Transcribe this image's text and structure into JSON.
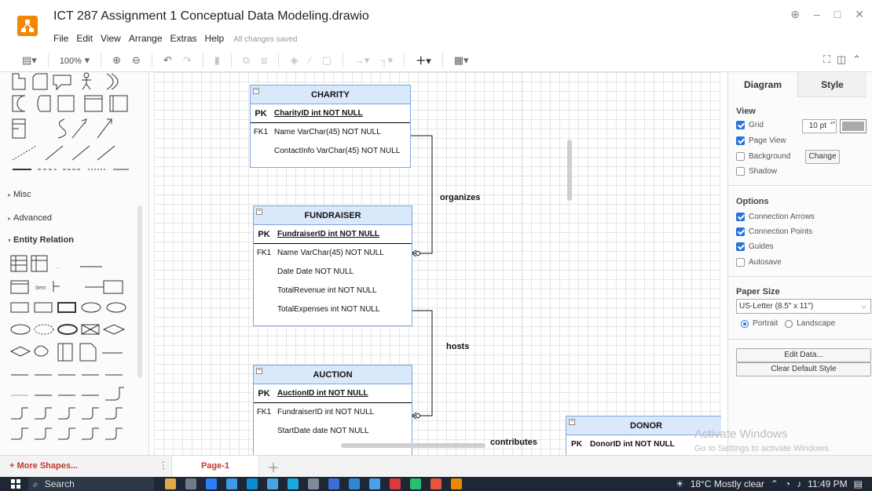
{
  "window": {
    "title": "ICT 287 Assignment 1 Conceptual Data Modeling.drawio",
    "save_status": "All changes saved",
    "menu": [
      "File",
      "Edit",
      "View",
      "Arrange",
      "Extras",
      "Help"
    ]
  },
  "toolbar": {
    "zoom": "100%",
    "icons": [
      "format-panel-toggle",
      "zoom-in-icon",
      "zoom-out-icon",
      "undo-icon",
      "redo-icon",
      "delete-icon",
      "to-front-icon",
      "to-back-icon",
      "fill-color-icon",
      "line-color-icon",
      "shadow-icon",
      "connection-icon",
      "waypoints-icon",
      "insert-plus-icon",
      "table-icon",
      "fullscreen-icon",
      "collapse-icon"
    ]
  },
  "shapes_panel": {
    "sections": {
      "misc": "Misc",
      "advanced": "Advanced",
      "entity_relation": "Entity Relation"
    },
    "item_label": "Item",
    "more_shapes": "+ More Shapes..."
  },
  "diagram": {
    "entities": {
      "charity": {
        "name": "CHARITY",
        "pk": {
          "key": "PK",
          "attr": "CharityID  int NOT NULL"
        },
        "rows": [
          {
            "key": "FK1",
            "attr": "Name VarChar(45) NOT NULL"
          },
          {
            "key": "",
            "attr": "ContactInfo  VarChar(45) NOT NULL"
          }
        ]
      },
      "fundraiser": {
        "name": "FUNDRAISER",
        "pk": {
          "key": "PK",
          "attr": "FundraiserID int NOT NULL"
        },
        "rows": [
          {
            "key": "FK1",
            "attr": "Name VarChar(45) NOT NULL"
          },
          {
            "key": "",
            "attr": "Date  Date NOT NULL"
          },
          {
            "key": "",
            "attr": "TotalRevenue int NOT NULL"
          },
          {
            "key": "",
            "attr": "TotalExpenses int NOT NULL"
          }
        ]
      },
      "auction": {
        "name": "AUCTION",
        "pk": {
          "key": "PK",
          "attr": "AuctionID  int NOT NULL"
        },
        "rows": [
          {
            "key": "FK1",
            "attr": "FundraiserID int NOT NULL"
          },
          {
            "key": "",
            "attr": "StartDate date NOT NULL"
          }
        ]
      },
      "donor": {
        "name": "DONOR",
        "pk": {
          "key": "PK",
          "attr": "DonorID int NOT NULL"
        }
      }
    },
    "relationships": {
      "organizes": "organizes",
      "hosts": "hosts",
      "contributes": "contributes"
    }
  },
  "format_panel": {
    "tabs": {
      "diagram": "Diagram",
      "style": "Style"
    },
    "view": {
      "title": "View",
      "grid": {
        "label": "Grid",
        "checked": true,
        "size": "10 pt"
      },
      "page_view": {
        "label": "Page View",
        "checked": true
      },
      "background": {
        "label": "Background",
        "checked": false,
        "button": "Change"
      },
      "shadow": {
        "label": "Shadow",
        "checked": false
      }
    },
    "options": {
      "title": "Options",
      "connection_arrows": {
        "label": "Connection Arrows",
        "checked": true
      },
      "connection_points": {
        "label": "Connection Points",
        "checked": true
      },
      "guides": {
        "label": "Guides",
        "checked": true
      },
      "autosave": {
        "label": "Autosave",
        "checked": false
      }
    },
    "paper": {
      "title": "Paper Size",
      "selected": "US-Letter (8.5\" x 11\")",
      "portrait": "Portrait",
      "landscape": "Landscape",
      "orientation": "Portrait"
    },
    "buttons": {
      "edit_data": "Edit Data...",
      "clear_default_style": "Clear Default Style"
    }
  },
  "pages": {
    "current": "Page-1"
  },
  "watermark": {
    "title": "Activate Windows",
    "subtitle": "Go to Settings to activate Windows."
  },
  "taskbar": {
    "search": "Search",
    "weather": "18°C  Mostly clear",
    "time": "11:49 PM"
  },
  "colors": {
    "accent_orange": "#f08705",
    "entity_header": "#dae8fc",
    "entity_border": "#7ea6e0",
    "checkbox_blue": "#2a73d9",
    "page_tab_text": "#c0392b"
  }
}
